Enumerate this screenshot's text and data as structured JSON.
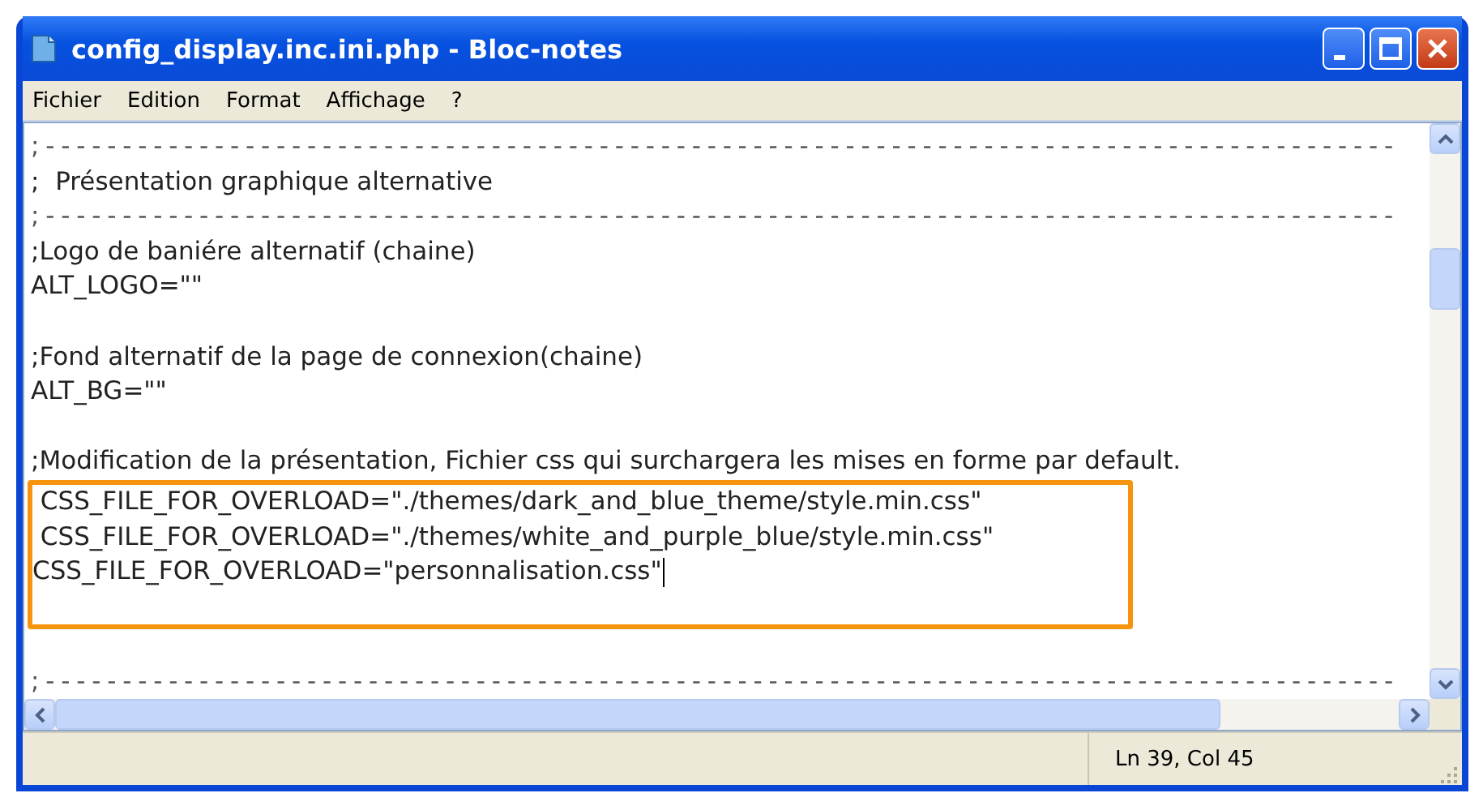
{
  "window": {
    "title": "config_display.inc.ini.php - Bloc-notes"
  },
  "menu": [
    "Fichier",
    "Edition",
    "Format",
    "Affichage",
    "?"
  ],
  "editor": {
    "lines": [
      {
        "kind": "rule",
        "text": ";----------------------------------------------------------------------------------------"
      },
      {
        "kind": "text",
        "text": ";  Présentation graphique alternative"
      },
      {
        "kind": "rule",
        "text": ";----------------------------------------------------------------------------------------"
      },
      {
        "kind": "text",
        "text": ";Logo de baniére alternatif (chaine)"
      },
      {
        "kind": "text",
        "text": "ALT_LOGO=\"\""
      },
      {
        "kind": "blank"
      },
      {
        "kind": "text",
        "text": ";Fond alternatif de la page de connexion(chaine)"
      },
      {
        "kind": "text",
        "text": "ALT_BG=\"\""
      },
      {
        "kind": "blank"
      },
      {
        "kind": "text",
        "text": ";Modification de la présentation, Fichier css qui surchargera les mises en forme par default."
      },
      {
        "kind": "highlight",
        "lines": [
          {
            "text": " CSS_FILE_FOR_OVERLOAD=\"./themes/dark_and_blue_theme/style.min.css\""
          },
          {
            "text": " CSS_FILE_FOR_OVERLOAD=\"./themes/white_and_purple_blue/style.min.css\""
          },
          {
            "text": "CSS_FILE_FOR_OVERLOAD=\"personnalisation.css\"",
            "cursor": true
          }
        ]
      },
      {
        "kind": "blank"
      },
      {
        "kind": "rule",
        "text": ";----------------------------------------------------------------------------------------"
      }
    ]
  },
  "status_bar": {
    "position": "Ln 39, Col 45"
  }
}
